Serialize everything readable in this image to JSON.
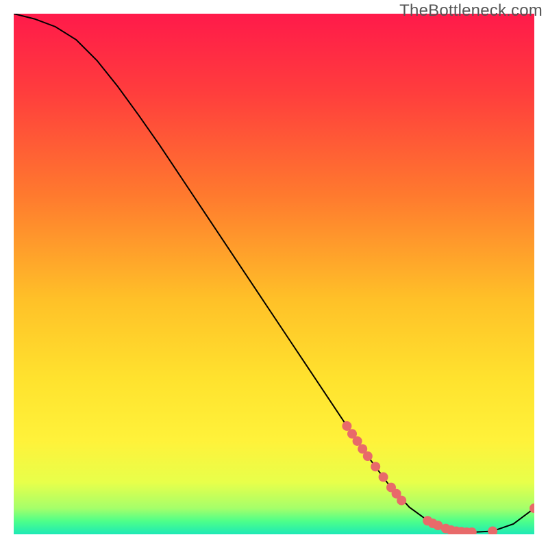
{
  "watermark": "TheBottleneck.com",
  "chart_data": {
    "type": "line",
    "title": "",
    "xlabel": "",
    "ylabel": "",
    "xlim": [
      0,
      100
    ],
    "ylim": [
      0,
      100
    ],
    "gradient_stops": [
      {
        "offset": 0.0,
        "color": "#ff1a4a"
      },
      {
        "offset": 0.15,
        "color": "#ff3d3d"
      },
      {
        "offset": 0.35,
        "color": "#ff7a2e"
      },
      {
        "offset": 0.55,
        "color": "#ffc128"
      },
      {
        "offset": 0.7,
        "color": "#ffe22e"
      },
      {
        "offset": 0.82,
        "color": "#fff23a"
      },
      {
        "offset": 0.9,
        "color": "#e8ff4a"
      },
      {
        "offset": 0.95,
        "color": "#a5ff6a"
      },
      {
        "offset": 0.975,
        "color": "#4dff8a"
      },
      {
        "offset": 1.0,
        "color": "#1de9b6"
      }
    ],
    "series": [
      {
        "name": "bottleneck-curve",
        "x": [
          0,
          4,
          8,
          12,
          16,
          20,
          24,
          28,
          32,
          36,
          40,
          44,
          48,
          52,
          56,
          60,
          64,
          68,
          72,
          76,
          80,
          84,
          88,
          92,
          96,
          100
        ],
        "y": [
          100,
          99,
          97.5,
          95,
          91,
          86,
          80.5,
          74.8,
          68.8,
          62.8,
          56.8,
          50.8,
          44.8,
          38.8,
          32.8,
          26.8,
          20.8,
          15.0,
          9.6,
          5.2,
          2.3,
          0.8,
          0.4,
          0.6,
          2.0,
          5.0
        ]
      }
    ],
    "markers": {
      "name": "highlight-points",
      "color": "#e86a6a",
      "radius": 7,
      "points": [
        {
          "x": 64.0,
          "y": 20.8
        },
        {
          "x": 65.0,
          "y": 19.3
        },
        {
          "x": 66.0,
          "y": 17.9
        },
        {
          "x": 67.0,
          "y": 16.4
        },
        {
          "x": 68.0,
          "y": 15.0
        },
        {
          "x": 69.5,
          "y": 13.0
        },
        {
          "x": 71.0,
          "y": 11.0
        },
        {
          "x": 72.5,
          "y": 9.0
        },
        {
          "x": 73.5,
          "y": 7.8
        },
        {
          "x": 74.5,
          "y": 6.5
        },
        {
          "x": 79.5,
          "y": 2.6
        },
        {
          "x": 80.5,
          "y": 2.1
        },
        {
          "x": 81.5,
          "y": 1.7
        },
        {
          "x": 83.0,
          "y": 1.1
        },
        {
          "x": 84.0,
          "y": 0.8
        },
        {
          "x": 85.0,
          "y": 0.6
        },
        {
          "x": 86.0,
          "y": 0.5
        },
        {
          "x": 87.0,
          "y": 0.4
        },
        {
          "x": 88.0,
          "y": 0.4
        },
        {
          "x": 92.0,
          "y": 0.6
        },
        {
          "x": 100.0,
          "y": 5.0
        }
      ]
    }
  }
}
